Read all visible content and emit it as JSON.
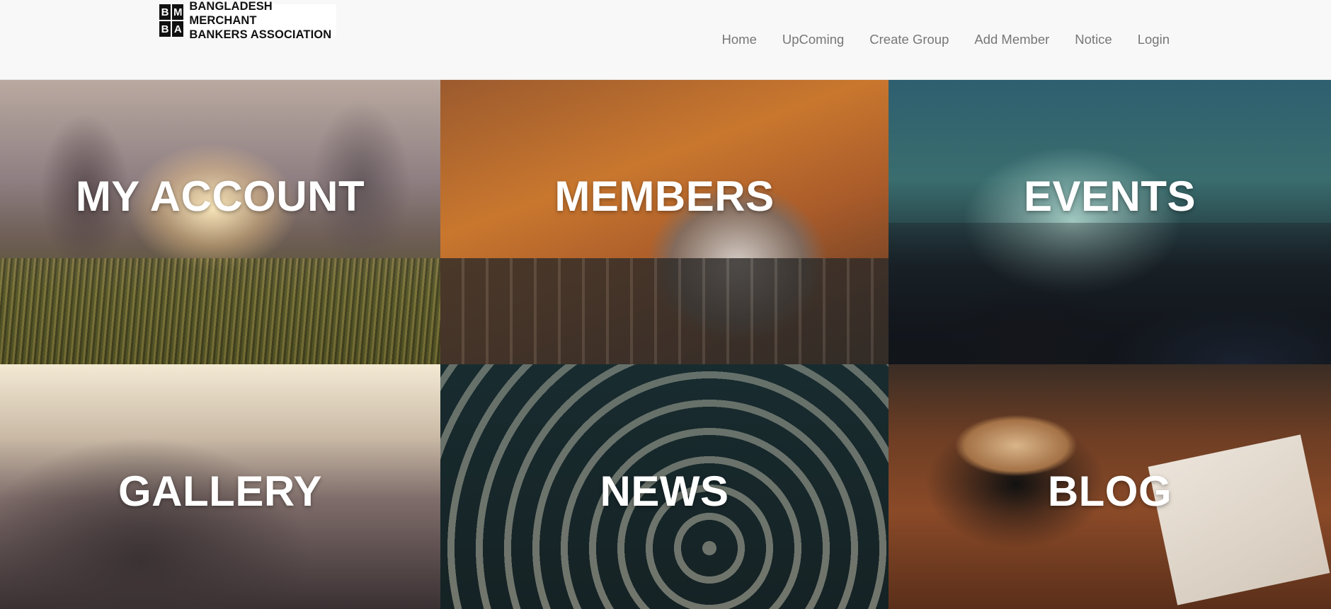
{
  "header": {
    "logo": {
      "mark_letters": [
        "B",
        "M",
        "B",
        "A"
      ],
      "line1": "BANGLADESH MERCHANT",
      "line2": "BANKERS ASSOCIATION"
    },
    "nav": [
      "Home",
      "UpComing",
      "Create Group",
      "Add Member",
      "Notice",
      "Login"
    ]
  },
  "tiles": [
    {
      "label": "MY ACCOUNT"
    },
    {
      "label": "MEMBERS"
    },
    {
      "label": "EVENTS"
    },
    {
      "label": "GALLERY"
    },
    {
      "label": "NEWS"
    },
    {
      "label": "BLOG"
    }
  ]
}
